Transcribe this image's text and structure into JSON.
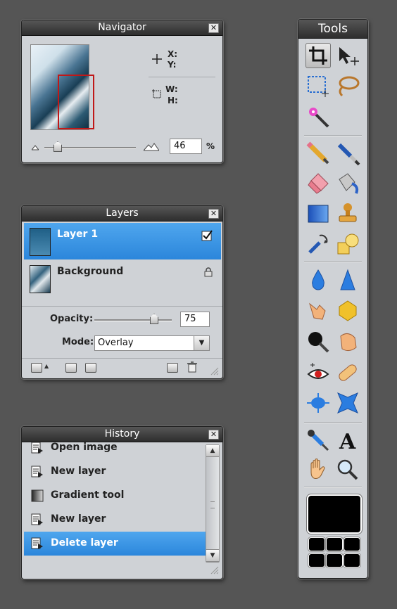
{
  "navigator": {
    "title": "Navigator",
    "close": "✕",
    "x_label": "X:",
    "y_label": "Y:",
    "w_label": "W:",
    "h_label": "H:",
    "zoom": "46",
    "zoom_unit": "%"
  },
  "layers": {
    "title": "Layers",
    "close": "✕",
    "items": [
      {
        "name": "Layer 1"
      },
      {
        "name": "Background"
      }
    ],
    "opacity_label": "Opacity:",
    "opacity_value": "75",
    "mode_label": "Mode:",
    "mode_value": "Overlay"
  },
  "history": {
    "title": "History",
    "close": "✕",
    "items": [
      {
        "label": "Open image",
        "icon": "document-icon"
      },
      {
        "label": "New layer",
        "icon": "document-icon"
      },
      {
        "label": "Gradient tool",
        "icon": "gradient-icon"
      },
      {
        "label": "New layer",
        "icon": "document-icon"
      },
      {
        "label": "Delete layer",
        "icon": "document-icon"
      }
    ]
  },
  "tools": {
    "title": "Tools",
    "items": [
      "crop",
      "move",
      "marquee",
      "lasso",
      "magic-wand",
      "pencil",
      "brush",
      "eraser",
      "paint-bucket",
      "gradient",
      "clone-stamp",
      "color-replace",
      "shape",
      "blur",
      "sharpen",
      "smudge",
      "sponge",
      "dodge",
      "burn",
      "red-eye",
      "spot-heal",
      "bloat",
      "pinch",
      "color-picker",
      "type",
      "hand",
      "zoom"
    ]
  },
  "colors": {
    "accent": "#2b86db",
    "panel_bg": "#cfd2d6",
    "foreground": "#000000"
  }
}
